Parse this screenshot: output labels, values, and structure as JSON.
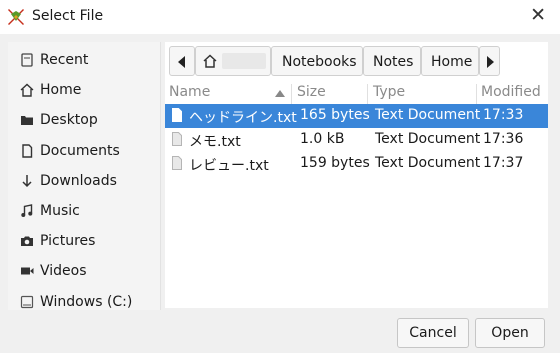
{
  "window": {
    "title": "Select File",
    "icon": "app-logo-icon"
  },
  "sidebar": {
    "items": [
      {
        "label": "Recent",
        "icon": "recent-icon"
      },
      {
        "label": "Home",
        "icon": "home-icon"
      },
      {
        "label": "Desktop",
        "icon": "folder-icon"
      },
      {
        "label": "Documents",
        "icon": "document-icon"
      },
      {
        "label": "Downloads",
        "icon": "download-icon"
      },
      {
        "label": "Music",
        "icon": "music-icon"
      },
      {
        "label": "Pictures",
        "icon": "camera-icon"
      },
      {
        "label": "Videos",
        "icon": "video-icon"
      },
      {
        "label": "Windows (C:)",
        "icon": "drive-icon"
      }
    ]
  },
  "pathbar": {
    "segments": [
      "Notebooks",
      "Notes",
      "Home"
    ]
  },
  "columns": {
    "name": "Name",
    "size": "Size",
    "type": "Type",
    "modified": "Modified"
  },
  "files": [
    {
      "name": "ヘッドライン.txt",
      "size": "165 bytes",
      "type": "Text Document",
      "modified": "17:33",
      "selected": true
    },
    {
      "name": "メモ.txt",
      "size": "1.0 kB",
      "type": "Text Document",
      "modified": "17:36",
      "selected": false
    },
    {
      "name": "レビュー.txt",
      "size": "159 bytes",
      "type": "Text Document",
      "modified": "17:37",
      "selected": false
    }
  ],
  "buttons": {
    "cancel": "Cancel",
    "open": "Open"
  },
  "colors": {
    "selection": "#3a86d9",
    "background": "#f0f0f0"
  }
}
